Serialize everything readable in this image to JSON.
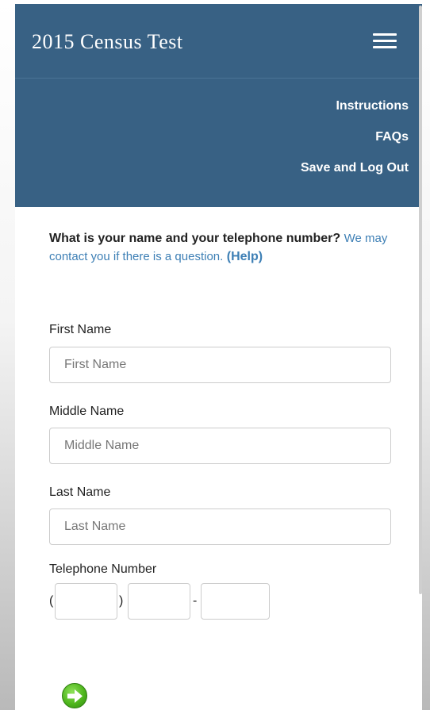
{
  "header": {
    "title": "2015 Census Test",
    "menu_icon": "hamburger-menu-icon",
    "nav_links": [
      "Instructions",
      "FAQs",
      "Save and Log Out"
    ]
  },
  "question": {
    "prompt": "What is your name and your telephone number?",
    "note": "We may contact you if there is a question.",
    "help_label": "(Help)"
  },
  "form": {
    "first_name": {
      "label": "First Name",
      "placeholder": "First Name",
      "value": ""
    },
    "middle_name": {
      "label": "Middle Name",
      "placeholder": "Middle Name",
      "value": ""
    },
    "last_name": {
      "label": "Last Name",
      "placeholder": "Last Name",
      "value": ""
    },
    "telephone": {
      "label": "Telephone Number",
      "open_paren": "(",
      "close_paren": ")",
      "dash": "-",
      "area_code": "",
      "prefix": "",
      "line_number": ""
    }
  },
  "next_button": {
    "icon": "arrow-right-icon",
    "color": "#4fb61d"
  },
  "colors": {
    "header_bg": "#386184",
    "link_blue": "#3d7fb5"
  }
}
